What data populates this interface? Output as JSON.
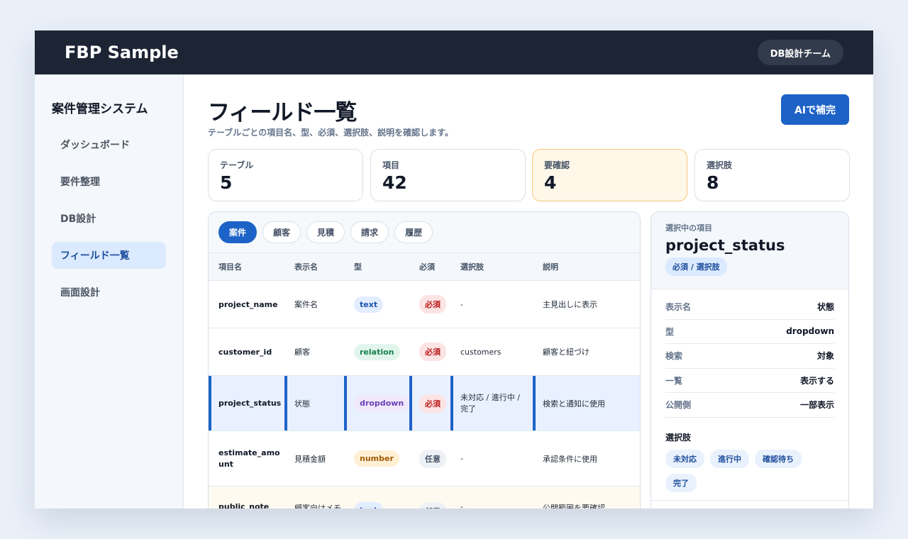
{
  "header": {
    "brand": "FBP Sample",
    "team": "DB設計チーム"
  },
  "sidebar": {
    "title": "案件管理システム",
    "items": [
      {
        "label": "ダッシュボード",
        "active": false
      },
      {
        "label": "要件整理",
        "active": false
      },
      {
        "label": "DB設計",
        "active": false
      },
      {
        "label": "フィールド一覧",
        "active": true
      },
      {
        "label": "画面設計",
        "active": false
      }
    ]
  },
  "page": {
    "title": "フィールド一覧",
    "subtitle": "テーブルごとの項目名、型、必須、選択肢、説明を確認します。",
    "ai_button": "AIで補完"
  },
  "stats": [
    {
      "label": "テーブル",
      "value": "5"
    },
    {
      "label": "項目",
      "value": "42"
    },
    {
      "label": "要確認",
      "value": "4"
    },
    {
      "label": "選択肢",
      "value": "8"
    }
  ],
  "tabs": [
    {
      "label": "案件",
      "active": true
    },
    {
      "label": "顧客",
      "active": false
    },
    {
      "label": "見積",
      "active": false
    },
    {
      "label": "請求",
      "active": false
    },
    {
      "label": "履歴",
      "active": false
    }
  ],
  "table": {
    "headers": [
      "項目名",
      "表示名",
      "型",
      "必須",
      "選択肢",
      "説明"
    ],
    "rows": [
      {
        "field": "project_name",
        "display": "案件名",
        "type": "text",
        "required": "必須",
        "options": "-",
        "desc": "主見出しに表示"
      },
      {
        "field": "customer_id",
        "display": "顧客",
        "type": "relation",
        "required": "必須",
        "options": "customers",
        "desc": "顧客と紐づけ"
      },
      {
        "field": "project_status",
        "display": "状態",
        "type": "dropdown",
        "required": "必須",
        "options": "未対応 / 進行中 / 完了",
        "desc": "検索と通知に使用"
      },
      {
        "field": "estimate_amount",
        "display": "見積金額",
        "type": "number",
        "required": "任意",
        "options": "-",
        "desc": "承認条件に使用"
      },
      {
        "field": "public_note",
        "display": "顧客向けメモ",
        "type": "text",
        "required": "任意",
        "options": "-",
        "desc": "公開範囲を要確認"
      }
    ]
  },
  "detail": {
    "caption": "選択中の項目",
    "name": "project_status",
    "badge": "必須 / 選択肢",
    "props": [
      {
        "k": "表示名",
        "v": "状態"
      },
      {
        "k": "型",
        "v": "dropdown"
      },
      {
        "k": "検索",
        "v": "対象"
      },
      {
        "k": "一覧",
        "v": "表示する"
      },
      {
        "k": "公開側",
        "v": "一部表示"
      }
    ],
    "options_title": "選択肢",
    "options": [
      "未対応",
      "進行中",
      "確認待ち",
      "完了"
    ]
  }
}
